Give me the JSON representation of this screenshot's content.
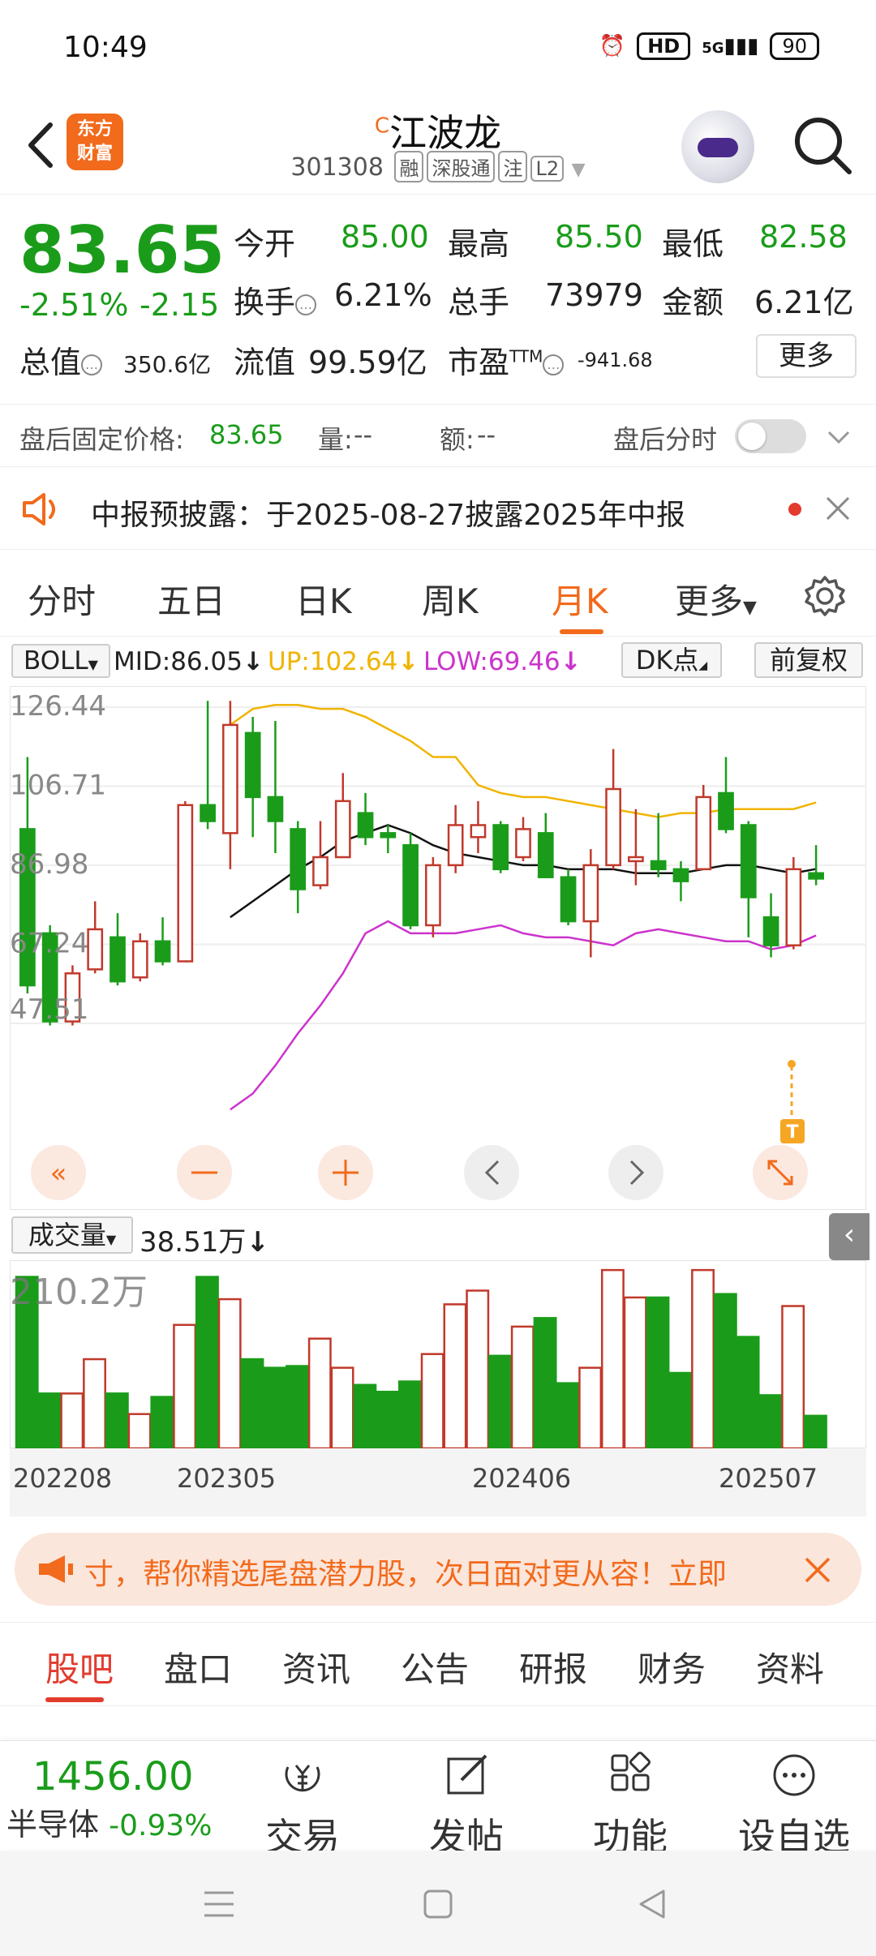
{
  "status_bar": {
    "time": "10:49",
    "network": "5G",
    "hd": "HD",
    "battery": "90"
  },
  "header": {
    "logo_line1": "东方",
    "logo_line2": "财富",
    "stock_name": "江波龙",
    "name_badge": "C",
    "stock_code": "301308",
    "tags": [
      "融",
      "深股通",
      "注",
      "L2"
    ]
  },
  "quote": {
    "last_price": "83.65",
    "change_pct": "-2.51%",
    "change_abs": "-2.15",
    "open_label": "今开",
    "open_value": "85.00",
    "high_label": "最高",
    "high_value": "85.50",
    "low_label": "最低",
    "low_value": "82.58",
    "turnover_label": "换手",
    "turnover_value": "6.21%",
    "volume_label": "总手",
    "volume_value": "73979",
    "amount_label": "金额",
    "amount_value": "6.21亿",
    "mktcap_label": "总值",
    "mktcap_value": "350.6亿",
    "float_label": "流值",
    "float_value": "99.59亿",
    "pe_label": "市盈",
    "pe_sup": "TTM",
    "pe_value": "-941.68",
    "more_label": "更多"
  },
  "after_hours": {
    "price_label": "盘后固定价格:",
    "price_value": "83.65",
    "vol_label": "量:",
    "vol_value": "--",
    "amt_label": "额:",
    "amt_value": "--",
    "intraday_label": "盘后分时"
  },
  "notice": {
    "text": "中报预披露：于2025-08-27披露2025年中报"
  },
  "period_tabs": [
    "分时",
    "五日",
    "日K",
    "周K",
    "月K",
    "更多"
  ],
  "active_period": "月K",
  "indicator": {
    "name": "BOLL",
    "mid": "MID:86.05",
    "up": "UP:102.64",
    "low": "LOW:69.46",
    "dk_label": "DK点",
    "adj_label": "前复权"
  },
  "colors": {
    "up": "#c0392b",
    "down": "#1a9c1a",
    "upper_band": "#f0b400",
    "mid_band": "#111111",
    "lower_band": "#cc33cc",
    "accent": "#f26a1b"
  },
  "chart_data": {
    "type": "candlestick",
    "y_ticks": [
      "126.44",
      "106.71",
      "86.98",
      "67.24",
      "47.51"
    ],
    "ylim": [
      47.51,
      126.44
    ],
    "x_ticks": [
      "202208",
      "202305",
      "202406",
      "202507"
    ],
    "candles": [
      {
        "o": 96,
        "c": 57,
        "h": 114,
        "l": 55
      },
      {
        "o": 70,
        "c": 48,
        "h": 72,
        "l": 47
      },
      {
        "o": 48,
        "c": 60,
        "h": 62,
        "l": 47
      },
      {
        "o": 61,
        "c": 71,
        "h": 78,
        "l": 60
      },
      {
        "o": 69,
        "c": 58,
        "h": 75,
        "l": 57
      },
      {
        "o": 59,
        "c": 68,
        "h": 70,
        "l": 58
      },
      {
        "o": 68,
        "c": 63,
        "h": 74,
        "l": 62
      },
      {
        "o": 63,
        "c": 102,
        "h": 103,
        "l": 63
      },
      {
        "o": 102,
        "c": 98,
        "h": 128,
        "l": 96
      },
      {
        "o": 95,
        "c": 122,
        "h": 128,
        "l": 86
      },
      {
        "o": 120,
        "c": 104,
        "h": 124,
        "l": 94
      },
      {
        "o": 104,
        "c": 98,
        "h": 123,
        "l": 90
      },
      {
        "o": 96,
        "c": 81,
        "h": 98,
        "l": 75
      },
      {
        "o": 82,
        "c": 89,
        "h": 98,
        "l": 81
      },
      {
        "o": 89,
        "c": 103,
        "h": 110,
        "l": 89
      },
      {
        "o": 100,
        "c": 94,
        "h": 105,
        "l": 92
      },
      {
        "o": 95,
        "c": 94,
        "h": 97,
        "l": 90
      },
      {
        "o": 92,
        "c": 72,
        "h": 95,
        "l": 71
      },
      {
        "o": 72,
        "c": 87,
        "h": 89,
        "l": 69
      },
      {
        "o": 87,
        "c": 97,
        "h": 102,
        "l": 85
      },
      {
        "o": 94,
        "c": 97,
        "h": 103,
        "l": 90
      },
      {
        "o": 97,
        "c": 86,
        "h": 98,
        "l": 85
      },
      {
        "o": 89,
        "c": 96,
        "h": 99,
        "l": 88
      },
      {
        "o": 95,
        "c": 84,
        "h": 100,
        "l": 84
      },
      {
        "o": 84,
        "c": 73,
        "h": 86,
        "l": 72
      },
      {
        "o": 73,
        "c": 87,
        "h": 91,
        "l": 64
      },
      {
        "o": 87,
        "c": 106,
        "h": 116,
        "l": 86
      },
      {
        "o": 88,
        "c": 89,
        "h": 101,
        "l": 82
      },
      {
        "o": 88,
        "c": 86,
        "h": 100,
        "l": 84
      },
      {
        "o": 86,
        "c": 83,
        "h": 88,
        "l": 78
      },
      {
        "o": 86,
        "c": 104,
        "h": 107,
        "l": 86
      },
      {
        "o": 105,
        "c": 96,
        "h": 114,
        "l": 95
      },
      {
        "o": 97,
        "c": 79,
        "h": 98,
        "l": 69
      },
      {
        "o": 74,
        "c": 67,
        "h": 80,
        "l": 64
      },
      {
        "o": 67,
        "c": 86,
        "h": 89,
        "l": 66
      },
      {
        "o": 85,
        "c": 83.65,
        "h": 92,
        "l": 82
      }
    ],
    "boll_upper": [
      null,
      null,
      null,
      null,
      null,
      null,
      null,
      null,
      null,
      122,
      126,
      127,
      127,
      126,
      126,
      124,
      121,
      118,
      114,
      114,
      107,
      105,
      104,
      104,
      103,
      102,
      101,
      100,
      99,
      100,
      100,
      101,
      101,
      101,
      101,
      102.64
    ],
    "boll_mid": [
      null,
      null,
      null,
      null,
      null,
      null,
      null,
      null,
      null,
      74,
      78,
      82,
      86,
      89,
      93,
      95,
      97,
      95,
      92,
      90,
      89,
      88,
      87,
      87,
      86,
      86,
      86,
      85,
      85,
      85,
      86,
      87,
      87,
      86,
      85,
      86.05
    ],
    "boll_lower": [
      null,
      null,
      null,
      null,
      null,
      null,
      null,
      null,
      null,
      26,
      30,
      37,
      45,
      52,
      60,
      70,
      73,
      70,
      70,
      70,
      71,
      72,
      70,
      69,
      69,
      68,
      67,
      70,
      71,
      70,
      69,
      68,
      68,
      66,
      67,
      69.46
    ],
    "volume_label": "成交量",
    "volume_current": "38.51万",
    "volume_max_label": "210.2万",
    "volume_values": [
      1.0,
      0.32,
      0.32,
      0.52,
      0.32,
      0.2,
      0.3,
      0.72,
      1.0,
      0.87,
      0.52,
      0.47,
      0.48,
      0.64,
      0.47,
      0.37,
      0.33,
      0.39,
      0.55,
      0.84,
      0.92,
      0.54,
      0.71,
      0.76,
      0.38,
      0.47,
      1.04,
      0.88,
      0.88,
      0.44,
      1.04,
      0.9,
      0.65,
      0.31,
      0.83,
      0.19
    ]
  },
  "promo": {
    "text": "寸，帮你精选尾盘潜力股，次日面对更从容！立即"
  },
  "content_tabs": [
    "股吧",
    "盘口",
    "资讯",
    "公告",
    "研报",
    "财务",
    "资料"
  ],
  "active_content_tab": "股吧",
  "bottom_bar": {
    "index_value": "1456.00",
    "index_name": "半导体",
    "index_change": "-0.93%",
    "trade_label": "交易",
    "post_label": "发帖",
    "function_label": "功能",
    "watchlist_label": "设自选"
  }
}
